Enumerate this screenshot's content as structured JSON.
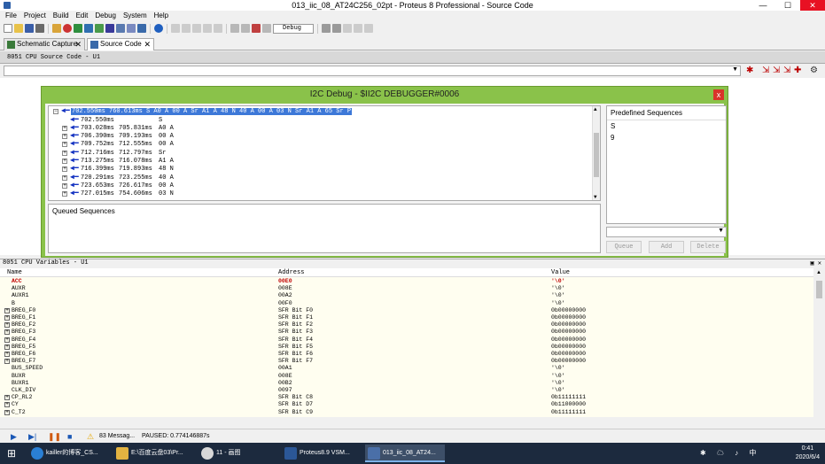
{
  "window": {
    "title": "013_iic_08_AT24C256_02pt - Proteus 8 Professional - Source Code",
    "min": "—",
    "max": "☐",
    "close": "✕"
  },
  "menu": [
    "File",
    "Project",
    "Build",
    "Edit",
    "Debug",
    "System",
    "Help"
  ],
  "toolbar": {
    "dropdown_value": "Debug"
  },
  "tabs": [
    {
      "label": "Schematic Capture"
    },
    {
      "label": "Source Code"
    }
  ],
  "source_pane": {
    "title": "8051 CPU Source Code - U1"
  },
  "dialog": {
    "title": "I2C Debug - $II2C DEBUGGER#0006",
    "close": "x",
    "tree": {
      "selected": "702.550ms 760.613ms S A0 A 00 A Sr A1 A 48 N 40 A 00 A 03 N Sr A1 A 65 Sr P",
      "rows": [
        {
          "start": "702.550ms",
          "end": "",
          "data": "S"
        },
        {
          "start": "703.028ms",
          "end": "705.831ms",
          "data": "A0 A"
        },
        {
          "start": "706.390ms",
          "end": "709.193ms",
          "data": "00 A"
        },
        {
          "start": "709.752ms",
          "end": "712.555ms",
          "data": "00 A"
        },
        {
          "start": "712.716ms",
          "end": "712.797ms",
          "data": "Sr"
        },
        {
          "start": "713.275ms",
          "end": "716.078ms",
          "data": "A1 A"
        },
        {
          "start": "716.399ms",
          "end": "719.893ms",
          "data": "48 N"
        },
        {
          "start": "720.291ms",
          "end": "723.255ms",
          "data": "40 A"
        },
        {
          "start": "723.653ms",
          "end": "726.617ms",
          "data": "00 A"
        },
        {
          "start": "727.015ms",
          "end": "754.606ms",
          "data": "03 N"
        }
      ]
    },
    "queued_label": "Queued Sequences",
    "predefined_label": "Predefined Sequences",
    "predefined_items": [
      "S",
      "9"
    ],
    "buttons": {
      "queue": "Queue",
      "add": "Add",
      "delete": "Delete"
    }
  },
  "cpu_vars": {
    "title": "8051 CPU Variables - U1",
    "columns": {
      "name": "Name",
      "address": "Address",
      "value": "Value"
    },
    "rows": [
      {
        "name": "ACC",
        "address": "00E0",
        "value": "'\\0'",
        "hl": true,
        "exp": false
      },
      {
        "name": "AUXR",
        "address": "008E",
        "value": "'\\0'",
        "hl": false,
        "exp": false
      },
      {
        "name": "AUXR1",
        "address": "00A2",
        "value": "'\\0'",
        "hl": false,
        "exp": false
      },
      {
        "name": "B",
        "address": "00F0",
        "value": "'\\0'",
        "hl": false,
        "exp": false
      },
      {
        "name": "BREG_F0",
        "address": "SFR Bit F0",
        "value": "0b00000000",
        "hl": false,
        "exp": true
      },
      {
        "name": "BREG_F1",
        "address": "SFR Bit F1",
        "value": "0b00000000",
        "hl": false,
        "exp": true
      },
      {
        "name": "BREG_F2",
        "address": "SFR Bit F2",
        "value": "0b00000000",
        "hl": false,
        "exp": true
      },
      {
        "name": "BREG_F3",
        "address": "SFR Bit F3",
        "value": "0b00000000",
        "hl": false,
        "exp": true
      },
      {
        "name": "BREG_F4",
        "address": "SFR Bit F4",
        "value": "0b00000000",
        "hl": false,
        "exp": true
      },
      {
        "name": "BREG_F5",
        "address": "SFR Bit F5",
        "value": "0b00000000",
        "hl": false,
        "exp": true
      },
      {
        "name": "BREG_F6",
        "address": "SFR Bit F6",
        "value": "0b00000000",
        "hl": false,
        "exp": true
      },
      {
        "name": "BREG_F7",
        "address": "SFR Bit F7",
        "value": "0b00000000",
        "hl": false,
        "exp": true
      },
      {
        "name": "BUS_SPEED",
        "address": "00A1",
        "value": "'\\0'",
        "hl": false,
        "exp": false
      },
      {
        "name": "BUXR",
        "address": "008E",
        "value": "'\\0'",
        "hl": false,
        "exp": false
      },
      {
        "name": "BUXR1",
        "address": "00B2",
        "value": "'\\0'",
        "hl": false,
        "exp": false
      },
      {
        "name": "CLK_DIV",
        "address": "0097",
        "value": "'\\0'",
        "hl": false,
        "exp": false
      },
      {
        "name": "CP_RL2",
        "address": "SFR Bit C8",
        "value": "0b11111111",
        "hl": false,
        "exp": true
      },
      {
        "name": "CY",
        "address": "SFR Bit D7",
        "value": "0b11000000",
        "hl": false,
        "exp": true
      },
      {
        "name": "C_T2",
        "address": "SFR Bit C9",
        "value": "0b11111111",
        "hl": false,
        "exp": true
      }
    ]
  },
  "status": {
    "messages": "83 Messag...",
    "paused": "PAUSED: 0.774146887s"
  },
  "taskbar": {
    "items": [
      "kailler的博客_CS...",
      "E:\\百度云盘03\\Pr...",
      "11 - 画图",
      "Proteus8.9 VSM...",
      "013_iic_08_AT24..."
    ],
    "time": "0:41",
    "date": "2020/6/4"
  }
}
